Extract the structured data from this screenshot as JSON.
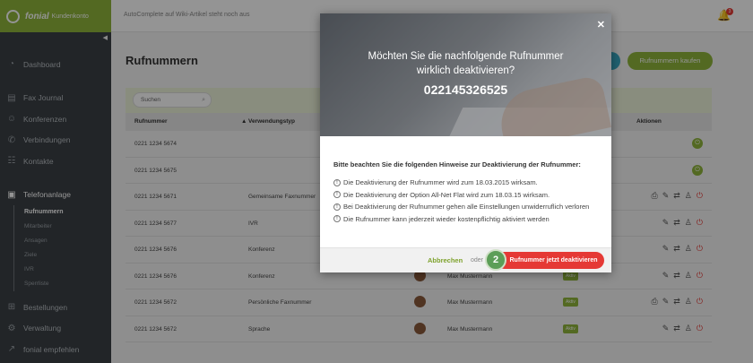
{
  "brand": {
    "name": "fonial",
    "sub": "Kundenkonto"
  },
  "topbar": {
    "search_placeholder": "AutoComplete auf Wiki-Artikel steht noch aus",
    "notification_count": "3"
  },
  "sidebar": {
    "items": [
      {
        "label": "Dashboard",
        "icon": "speedometer-icon"
      },
      {
        "label": "Fax Journal",
        "icon": "printer-icon"
      },
      {
        "label": "Konferenzen",
        "icon": "people-icon"
      },
      {
        "label": "Verbindungen",
        "icon": "phone-icon"
      },
      {
        "label": "Kontakte",
        "icon": "contacts-icon"
      },
      {
        "label": "Telefonanlage",
        "icon": "phone-system-icon"
      }
    ],
    "subitems": [
      "Rufnummern",
      "Mitarbeiter",
      "Ansagen",
      "Ziele",
      "IVR",
      "Sperrliste"
    ],
    "bottom_items": [
      {
        "label": "Bestellungen",
        "icon": "cart-icon"
      },
      {
        "label": "Verwaltung",
        "icon": "gear-icon"
      },
      {
        "label": "fonial empfehlen",
        "icon": "share-icon"
      }
    ]
  },
  "main": {
    "title": "Rufnummern",
    "buy_button": "Rufnummern kaufen",
    "search_placeholder": "Suchen",
    "columns": {
      "number": "Rufnummer",
      "type": "Verwendungstyp",
      "actions": "Aktionen"
    },
    "rows": [
      {
        "number": "0221 1234 5674",
        "type": "",
        "user": "",
        "status": ""
      },
      {
        "number": "0221 1234 5675",
        "type": "",
        "user": "",
        "status": ""
      },
      {
        "number": "0221 1234 5671",
        "type": "Gemeinsame Faxnummer",
        "user": "",
        "status": ""
      },
      {
        "number": "0221 1234 5677",
        "type": "IVR",
        "user": "",
        "status": ""
      },
      {
        "number": "0221 1234 5676",
        "type": "Konferenz",
        "user": "",
        "status": ""
      },
      {
        "number": "0221 1234 5676",
        "type": "Konferenz",
        "user": "Max Mustermann",
        "status": "Aktiv"
      },
      {
        "number": "0221 1234 5672",
        "type": "Persönliche Faxnummer",
        "user": "Max Mustermann",
        "status": "Aktiv"
      },
      {
        "number": "0221 1234 5672",
        "type": "Sprache",
        "user": "Max Mustermann",
        "status": "Aktiv"
      }
    ]
  },
  "modal": {
    "question": "Möchten Sie die nachfolgende Rufnummer wirklich deaktivieren?",
    "number": "022145326525",
    "heading": "Bitte beachten Sie die folgenden Hinweise zur Deaktivierung der Rufnummer:",
    "hints": [
      "Die Deaktivierung der Rufnummer wird zum 18.03.2015 wirksam.",
      "Die Deaktivierung der Option All-Net Flat wird zum 18.03.15 wirksam.",
      "Bei Deaktivierung der Rufnummer gehen alle Einstellungen unwiderruflich verloren",
      "Die Rufnummer kann jederzeit wieder kostenpflichtig aktiviert werden"
    ],
    "cancel": "Abbrechen",
    "or": "oder",
    "confirm": "Rufnummer jetzt deaktivieren",
    "step": "2",
    "close_glyph": "✕"
  },
  "colors": {
    "brand_green": "#8fb63c",
    "danger_red": "#e53935",
    "sidebar_bg": "#3c4146"
  }
}
